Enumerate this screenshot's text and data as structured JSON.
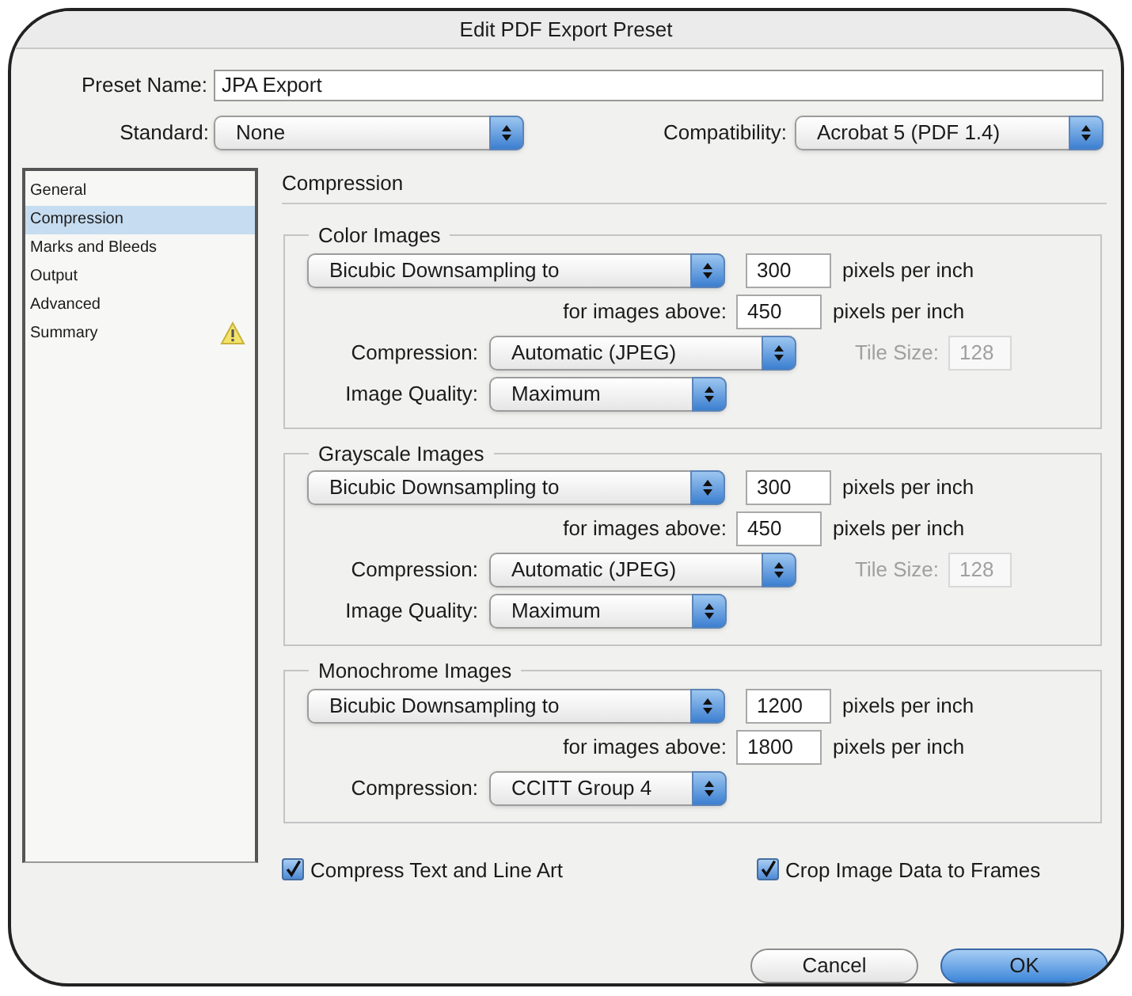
{
  "window": {
    "title": "Edit PDF Export Preset"
  },
  "preset_name": {
    "label": "Preset Name:",
    "value": "JPA Export"
  },
  "standard": {
    "label": "Standard:",
    "value": "None"
  },
  "compatibility": {
    "label": "Compatibility:",
    "value": "Acrobat 5 (PDF 1.4)"
  },
  "sidebar": {
    "items": [
      {
        "label": "General",
        "selected": false,
        "warning": false
      },
      {
        "label": "Compression",
        "selected": true,
        "warning": false
      },
      {
        "label": "Marks and Bleeds",
        "selected": false,
        "warning": false
      },
      {
        "label": "Output",
        "selected": false,
        "warning": false
      },
      {
        "label": "Advanced",
        "selected": false,
        "warning": false
      },
      {
        "label": "Summary",
        "selected": false,
        "warning": true
      }
    ]
  },
  "section_title": "Compression",
  "groups": [
    {
      "title": "Color Images",
      "sampling": "Bicubic Downsampling to",
      "resolution": "300",
      "resolution_unit": "pixels per inch",
      "above_label": "for images above:",
      "above": "450",
      "above_unit": "pixels per inch",
      "compression_label": "Compression:",
      "compression": "Automatic (JPEG)",
      "tile_label": "Tile Size:",
      "tile_size": "128",
      "tile_disabled": true,
      "quality_label": "Image Quality:",
      "quality": "Maximum"
    },
    {
      "title": "Grayscale Images",
      "sampling": "Bicubic Downsampling to",
      "resolution": "300",
      "resolution_unit": "pixels per inch",
      "above_label": "for images above:",
      "above": "450",
      "above_unit": "pixels per inch",
      "compression_label": "Compression:",
      "compression": "Automatic (JPEG)",
      "tile_label": "Tile Size:",
      "tile_size": "128",
      "tile_disabled": true,
      "quality_label": "Image Quality:",
      "quality": "Maximum"
    },
    {
      "title": "Monochrome Images",
      "sampling": "Bicubic Downsampling to",
      "resolution": "1200",
      "resolution_unit": "pixels per inch",
      "above_label": "for images above:",
      "above": "1800",
      "above_unit": "pixels per inch",
      "compression_label": "Compression:",
      "compression": "CCITT Group 4"
    }
  ],
  "options": [
    {
      "label": "Compress Text and Line Art",
      "checked": true
    },
    {
      "label": "Crop Image Data to Frames",
      "checked": true
    }
  ],
  "buttons": [
    {
      "label": "Cancel",
      "default": false
    },
    {
      "label": "OK",
      "default": true
    }
  ]
}
